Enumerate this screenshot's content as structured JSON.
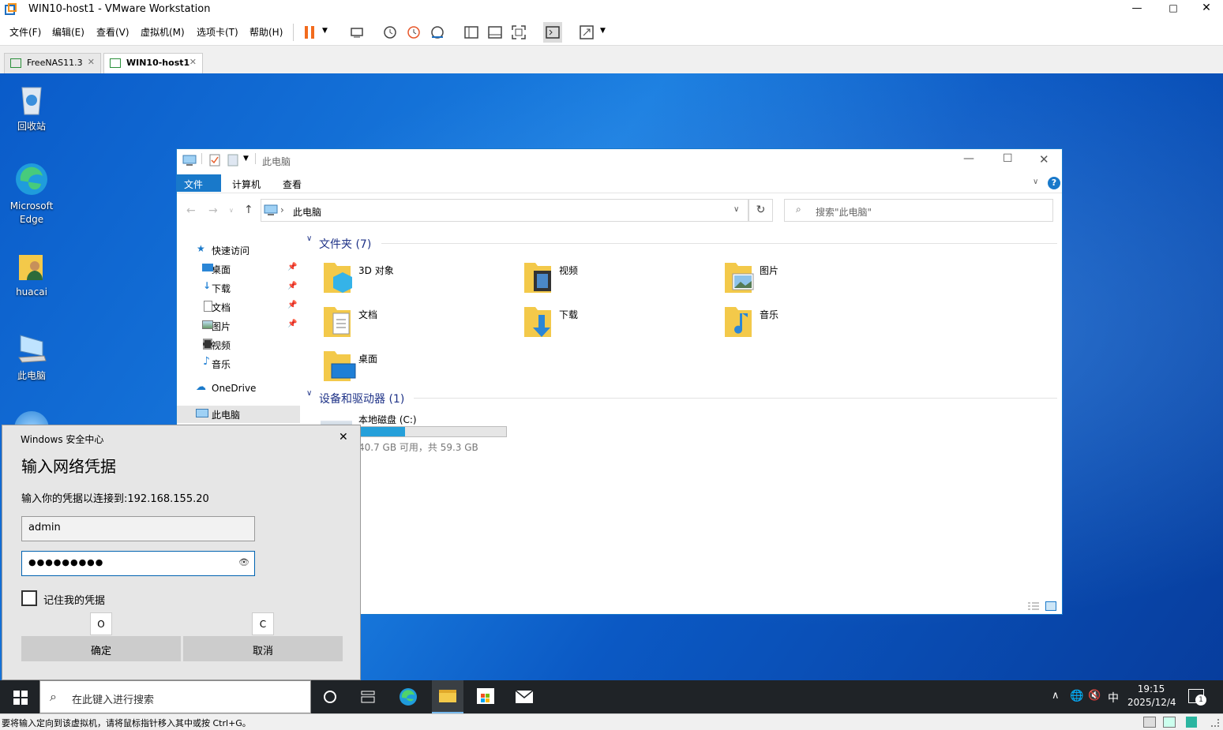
{
  "window": {
    "title": "WIN10-host1 - VMware Workstation"
  },
  "menu": [
    "文件(F)",
    "编辑(E)",
    "查看(V)",
    "虚拟机(M)",
    "选项卡(T)",
    "帮助(H)"
  ],
  "tabs": [
    {
      "label": "FreeNAS11.3"
    },
    {
      "label": "WIN10-host1"
    }
  ],
  "desktop_icons": [
    "回收站",
    "Microsoft Edge",
    "huacai",
    "此电脑"
  ],
  "explorer": {
    "title": "此电脑",
    "ribbon_tabs": [
      "文件",
      "计算机",
      "查看"
    ],
    "address": "此电脑",
    "search_placeholder": "搜索\"此电脑\"",
    "nav": {
      "quick_access": "快速访问",
      "items": [
        "桌面",
        "下载",
        "文档",
        "图片",
        "视频",
        "音乐"
      ],
      "onedrive": "OneDrive",
      "this_pc": "此电脑"
    },
    "folders_header": "文件夹 (7)",
    "folders": [
      "3D 对象",
      "视频",
      "图片",
      "文档",
      "下载",
      "音乐",
      "桌面"
    ],
    "drives_header": "设备和驱动器 (1)",
    "drive": {
      "name": "本地磁盘 (C:)",
      "info": "40.7 GB 可用，共 59.3 GB",
      "used_fraction": 0.31
    }
  },
  "dialog": {
    "app": "Windows 安全中心",
    "title": "输入网络凭据",
    "prompt": "输入你的凭据以连接到:192.168.155.20",
    "username": "admin",
    "password": "●●●●●●●●●",
    "remember": "记住我的凭据",
    "key_o": "O",
    "key_c": "C",
    "ok": "确定",
    "cancel": "取消"
  },
  "taskbar": {
    "search": "在此键入进行搜索",
    "ime": "中",
    "time": "19:15",
    "date": "2025/12/4",
    "notif_count": "1"
  },
  "statusbar": {
    "text": "要将输入定向到该虚拟机，请将鼠标指针移入其中或按 Ctrl+G。"
  },
  "colors": {
    "accent": "#0063b1",
    "desktop": "#0a5bc9",
    "folder": "#f3c94a"
  }
}
